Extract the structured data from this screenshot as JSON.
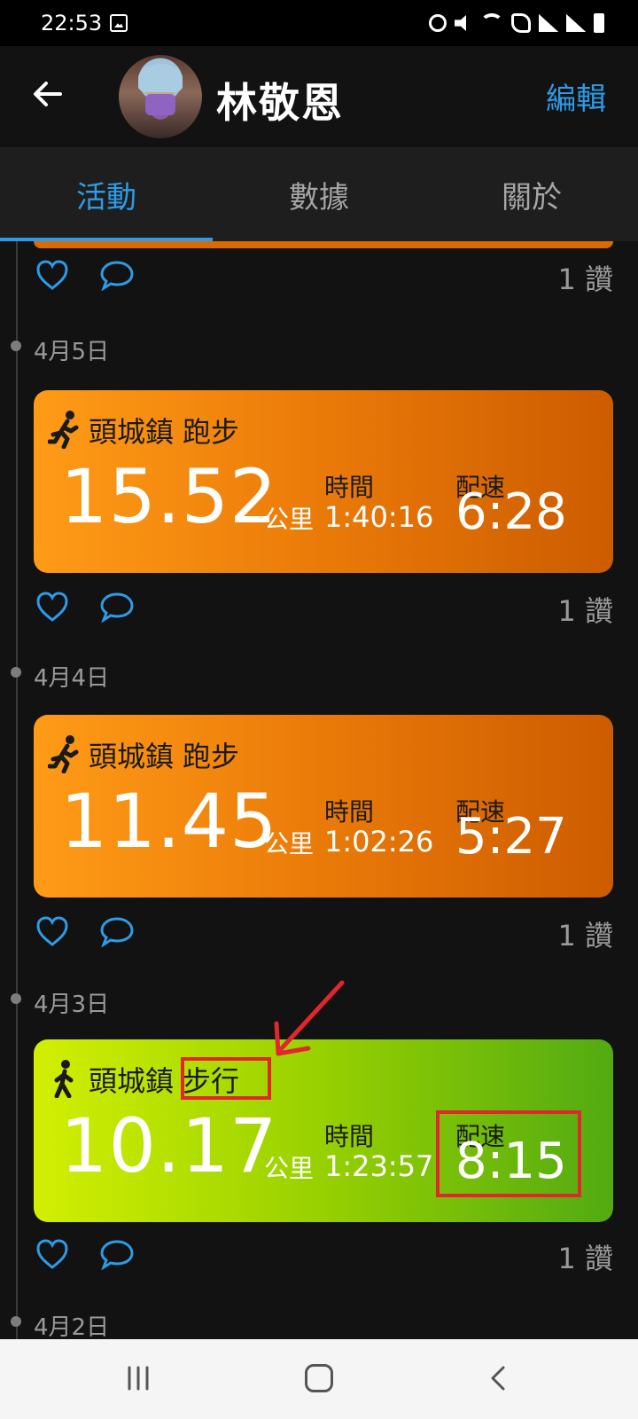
{
  "status_bar": {
    "time": "22:53"
  },
  "header": {
    "name": "林敬恩",
    "edit_label": "編輯"
  },
  "tabs": [
    {
      "label": "活動",
      "active": true
    },
    {
      "label": "數據",
      "active": false
    },
    {
      "label": "關於",
      "active": false
    }
  ],
  "colors": {
    "accent": "#2d9be6",
    "run_card": "#ff9b17",
    "walk_card": "#d2ef02",
    "annotation": "#e1262d"
  },
  "feed": {
    "top_likes": "1 讚",
    "entries": [
      {
        "date": "4月5日",
        "icon": "running-icon",
        "location": "頭城鎮",
        "type": "跑步",
        "distance": "15.52",
        "distance_unit": "公里",
        "time_label": "時間",
        "time": "1:40:16",
        "pace_label": "配速",
        "pace": "6:28",
        "likes": "1 讚"
      },
      {
        "date": "4月4日",
        "icon": "running-icon",
        "location": "頭城鎮",
        "type": "跑步",
        "distance": "11.45",
        "distance_unit": "公里",
        "time_label": "時間",
        "time": "1:02:26",
        "pace_label": "配速",
        "pace": "5:27",
        "likes": "1 讚"
      },
      {
        "date": "4月3日",
        "icon": "walking-icon",
        "location": "頭城鎮",
        "type": "步行",
        "distance": "10.17",
        "distance_unit": "公里",
        "time_label": "時間",
        "time": "1:23:57",
        "pace_label": "配速",
        "pace": "8:15",
        "likes": "1 讚"
      }
    ],
    "next_date": "4月2日"
  }
}
